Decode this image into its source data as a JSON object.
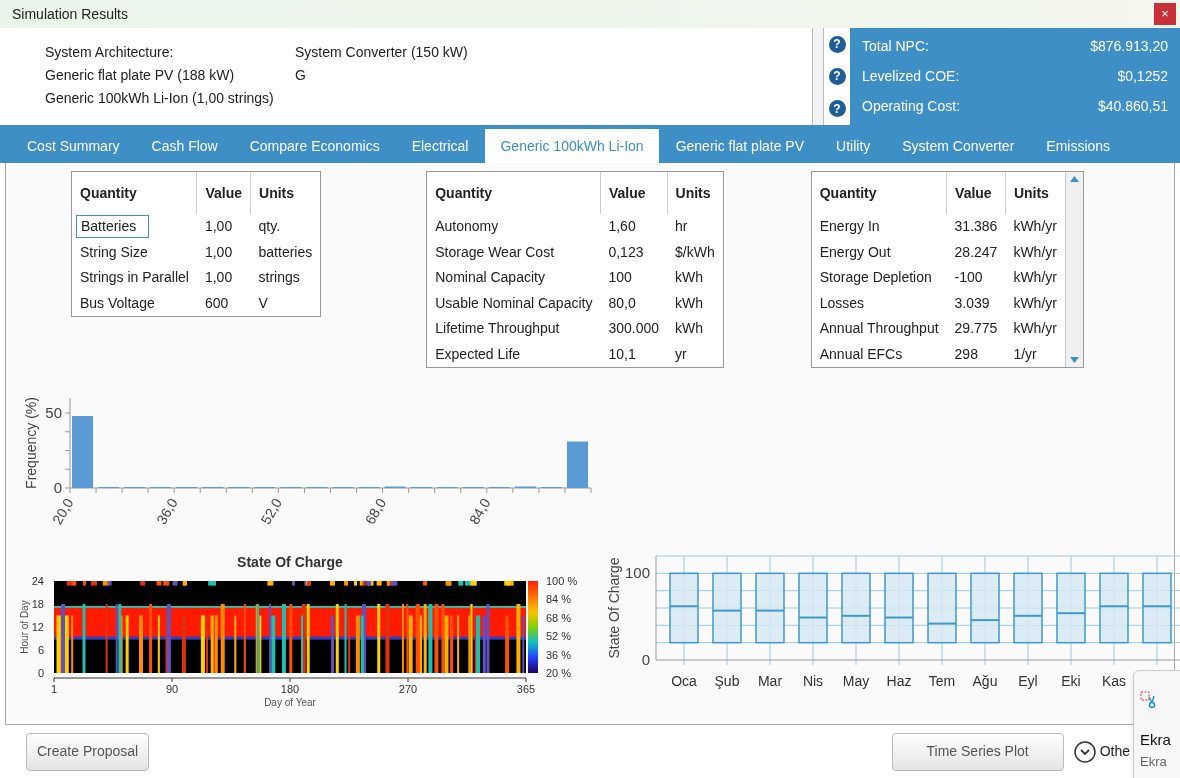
{
  "window": {
    "title": "Simulation Results",
    "close": "×"
  },
  "architecture": {
    "rows": [
      [
        "System Architecture:",
        "System Converter (150 kW)"
      ],
      [
        "Generic flat plate PV (188 kW)",
        "G"
      ],
      [
        "Generic 100kWh Li-Ion (1,00 strings)"
      ]
    ]
  },
  "summary": [
    {
      "help": "?",
      "label": "Total NPC:",
      "value": "$876.913,20"
    },
    {
      "help": "?",
      "label": "Levelized COE:",
      "value": "$0,1252"
    },
    {
      "help": "?",
      "label": "Operating Cost:",
      "value": "$40.860,51"
    }
  ],
  "tabs": [
    {
      "label": "Cost Summary",
      "selected": false
    },
    {
      "label": "Cash Flow",
      "selected": false
    },
    {
      "label": "Compare Economics",
      "selected": false
    },
    {
      "label": "Electrical",
      "selected": false
    },
    {
      "label": "Generic 100kWh Li-Ion",
      "selected": true
    },
    {
      "label": "Generic flat plate PV",
      "selected": false
    },
    {
      "label": "Utility",
      "selected": false
    },
    {
      "label": "System Converter",
      "selected": false
    },
    {
      "label": "Emissions",
      "selected": false
    }
  ],
  "tables": [
    {
      "columns": [
        "Quantity",
        "Value",
        "Units"
      ],
      "scrollbar": false,
      "rows": [
        {
          "cells": [
            "Batteries",
            "1,00",
            "qty."
          ],
          "selected": true
        },
        {
          "cells": [
            "String Size",
            "1,00",
            "batteries"
          ],
          "selected": false
        },
        {
          "cells": [
            "Strings in Parallel",
            "1,00",
            "strings"
          ],
          "selected": false
        },
        {
          "cells": [
            "Bus Voltage",
            "600",
            "V"
          ],
          "selected": false
        }
      ]
    },
    {
      "columns": [
        "Quantity",
        "Value",
        "Units"
      ],
      "scrollbar": false,
      "rows": [
        {
          "cells": [
            "Autonomy",
            "1,60",
            "hr"
          ],
          "selected": false
        },
        {
          "cells": [
            "Storage Wear Cost",
            "0,123",
            "$/kWh"
          ],
          "selected": false
        },
        {
          "cells": [
            "Nominal Capacity",
            "100",
            "kWh"
          ],
          "selected": false
        },
        {
          "cells": [
            "Usable Nominal Capacity",
            "80,0",
            "kWh"
          ],
          "selected": false
        },
        {
          "cells": [
            "Lifetime Throughput",
            "300.000",
            "kWh"
          ],
          "selected": false
        },
        {
          "cells": [
            "Expected Life",
            "10,1",
            "yr"
          ],
          "selected": false
        }
      ]
    },
    {
      "columns": [
        "Quantity",
        "Value",
        "Units"
      ],
      "scrollbar": true,
      "rows": [
        {
          "cells": [
            "Energy In",
            "31.386",
            "kWh/yr"
          ],
          "selected": false
        },
        {
          "cells": [
            "Energy Out",
            "28.247",
            "kWh/yr"
          ],
          "selected": false
        },
        {
          "cells": [
            "Storage Depletion",
            "-100",
            "kWh/yr"
          ],
          "selected": false
        },
        {
          "cells": [
            "Losses",
            "3.039",
            "kWh/yr"
          ],
          "selected": false
        },
        {
          "cells": [
            "Annual Throughput",
            "29.775",
            "kWh/yr"
          ],
          "selected": false
        },
        {
          "cells": [
            "Annual EFCs",
            "298",
            "1/yr"
          ],
          "selected": false
        }
      ]
    }
  ],
  "histogram": {
    "chart_data": {
      "type": "bar",
      "ylabel": "Frequency (%)",
      "x": [
        22,
        26,
        30,
        34,
        38,
        42,
        46,
        50,
        54,
        58,
        62,
        66,
        70,
        74,
        78,
        82,
        86,
        90,
        94,
        98
      ],
      "xlim": [
        20,
        100
      ],
      "values": [
        48,
        0,
        0,
        0,
        0,
        0,
        0,
        0,
        0,
        0,
        0,
        0,
        1,
        0,
        0,
        0,
        0,
        1,
        0,
        31
      ],
      "xticks": [
        {
          "value": 20,
          "label": "20,0"
        },
        {
          "value": 36,
          "label": "36,0"
        },
        {
          "value": 52,
          "label": "52,0"
        },
        {
          "value": 68,
          "label": "68,0"
        },
        {
          "value": 84,
          "label": "84,0"
        }
      ],
      "yticks": [
        0,
        50
      ],
      "ylim": [
        0,
        60
      ]
    }
  },
  "heatmap": {
    "title": "State Of Charge",
    "xlabel": "Day of Year",
    "ylabel": "Hour of Day",
    "xticks": [
      "1",
      "90",
      "180",
      "270",
      "365"
    ],
    "yticks": [
      "24",
      "18",
      "12",
      "6",
      "0"
    ],
    "scale": [
      "100 %",
      "84 %",
      "68 %",
      "52 %",
      "36 %",
      "20 %"
    ]
  },
  "boxplot": {
    "ylabel": "State Of Charge",
    "yticks": [
      "100",
      "0"
    ],
    "months": [
      "Oca",
      "Şub",
      "Mar",
      "Nis",
      "May",
      "Haz",
      "Tem",
      "Ağu",
      "Eyl",
      "Eki",
      "Kas"
    ]
  },
  "buttons": {
    "left": "Create Proposal",
    "right": "Time Series Plot",
    "other": "Othe"
  },
  "notification": {
    "title": "Ekra",
    "subtitle": "Ekra"
  }
}
